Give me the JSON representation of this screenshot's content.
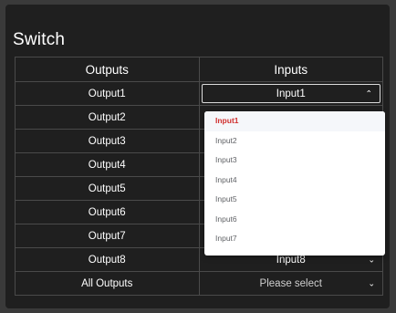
{
  "panel": {
    "title": "Switch"
  },
  "table": {
    "headers": {
      "outputs": "Outputs",
      "inputs": "Inputs"
    },
    "rows": [
      {
        "output": "Output1",
        "input": "Input1"
      },
      {
        "output": "Output2",
        "input": ""
      },
      {
        "output": "Output3",
        "input": ""
      },
      {
        "output": "Output4",
        "input": ""
      },
      {
        "output": "Output5",
        "input": ""
      },
      {
        "output": "Output6",
        "input": ""
      },
      {
        "output": "Output7",
        "input": ""
      },
      {
        "output": "Output8",
        "input": "Input8"
      }
    ],
    "all_outputs": {
      "label": "All Outputs",
      "placeholder": "Please select"
    }
  },
  "dropdown": {
    "selected": "Input1",
    "options": [
      "Input1",
      "Input2",
      "Input3",
      "Input4",
      "Input5",
      "Input6",
      "Input7"
    ]
  },
  "icons": {
    "open": "chevron-up-icon",
    "closed": "chevron-down-icon"
  },
  "colors": {
    "selected_option": "#d0302f",
    "panel_bg": "#1f1f1f",
    "grid_border": "#4a4a4a"
  }
}
